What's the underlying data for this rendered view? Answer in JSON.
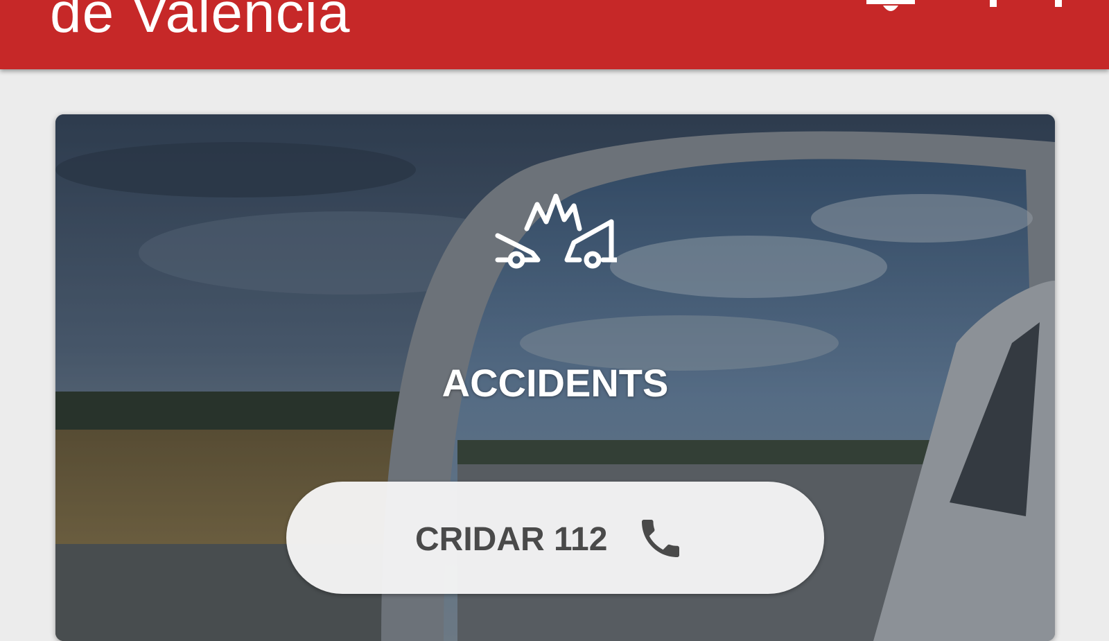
{
  "header": {
    "title": "de València",
    "background_color": "#c62828",
    "icons": [
      "bell-icon",
      "menu-icon"
    ]
  },
  "card": {
    "icon": "car-crash-icon",
    "title": "ACCIDENTS",
    "call_button": {
      "label": "CRIDAR 112",
      "icon": "phone-icon"
    }
  }
}
